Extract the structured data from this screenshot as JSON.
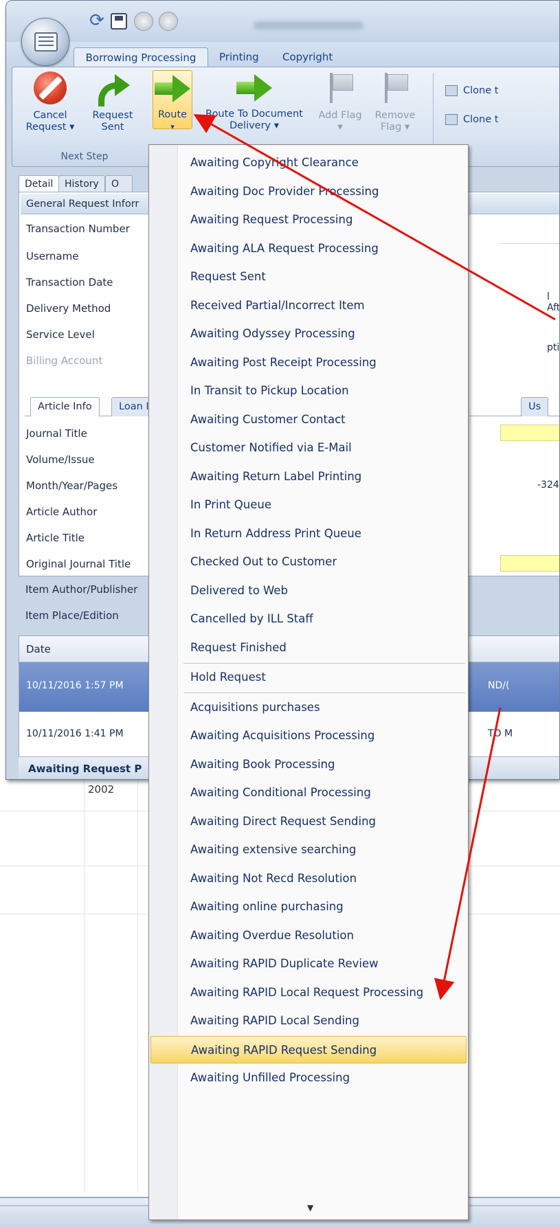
{
  "ribbon": {
    "tabs": [
      "Borrowing Processing",
      "Printing",
      "Copyright"
    ],
    "buttons": {
      "cancel_line1": "Cancel",
      "cancel_line2": "Request ▾",
      "request_sent_line1": "Request",
      "request_sent_line2": "Sent",
      "route_line1": "Route",
      "route_line2": "▾",
      "route_doc_line1": "Route To Document",
      "route_doc_line2": "Delivery ▾",
      "add_flag_line1": "Add Flag",
      "add_flag_line2": "▾",
      "remove_flag_line1": "Remove",
      "remove_flag_line2": "Flag ▾"
    },
    "group_label": "Next Step",
    "clone_1": "Clone t",
    "clone_2": "Clone t"
  },
  "detail": {
    "tabs": [
      "Detail",
      "History",
      "O"
    ],
    "group_header": "General Request Inforr",
    "fields": [
      "Transaction Number",
      "Username",
      "Transaction Date",
      "Delivery Method",
      "Service Level",
      "Billing Account"
    ],
    "tail_1": "l Aft",
    "tail_2": "ptior"
  },
  "article": {
    "tabs": [
      "Article Info",
      "Loan I",
      "Us"
    ],
    "fields": [
      "Journal Title",
      "Volume/Issue",
      "Month/Year/Pages",
      "Article Author",
      "Article Title",
      "Original Journal Title",
      "Item Author/Publisher",
      "Item Place/Edition"
    ],
    "tail_pages": "-324"
  },
  "history": {
    "header": "Date",
    "rows": [
      {
        "date": "10/11/2016 1:57 PM",
        "tail": "ND/("
      },
      {
        "date": "10/11/2016 1:41 PM",
        "tail": "TO M"
      }
    ]
  },
  "status": "Awaiting Request P",
  "sheet_year": "2002",
  "route_menu": {
    "items": [
      "Awaiting Copyright Clearance",
      "Awaiting Doc Provider Processing",
      "Awaiting Request Processing",
      "Awaiting ALA Request Processing",
      "Request Sent",
      "Received Partial/Incorrect Item",
      "Awaiting Odyssey Processing",
      "Awaiting Post Receipt Processing",
      "In Transit to Pickup Location",
      "Awaiting Customer Contact",
      "Customer Notified via E-Mail",
      "Awaiting Return Label Printing",
      "In Print Queue",
      "In Return Address Print Queue",
      "Checked Out to Customer",
      "Delivered to Web",
      "Cancelled by ILL Staff",
      "Request Finished",
      "Hold Request",
      "Acquisitions purchases",
      "Awaiting Acquisitions Processing",
      "Awaiting Book Processing",
      "Awaiting Conditional Processing",
      "Awaiting Direct Request Sending",
      "Awaiting extensive searching",
      "Awaiting Not Recd Resolution",
      "Awaiting online purchasing",
      "Awaiting Overdue Resolution",
      "Awaiting RAPID Duplicate Review",
      "Awaiting RAPID Local Request Processing",
      "Awaiting RAPID Local Sending",
      "Awaiting RAPID Request Sending",
      "Awaiting Unfilled Processing"
    ],
    "highlighted": "Awaiting RAPID Request Sending",
    "scroll_arrow": "▼"
  },
  "colors": {
    "annotation_arrow": "#e3120b",
    "menu_highlight": "#f7d569",
    "ribbon_text": "#15428b"
  }
}
